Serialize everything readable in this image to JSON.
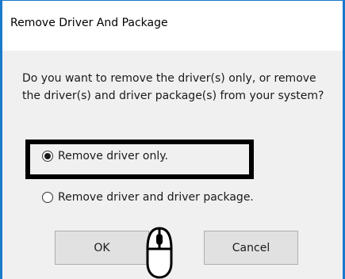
{
  "dialog": {
    "title": "Remove Driver And Package",
    "message": "Do you want to remove the driver(s) only, or remove the driver(s) and driver package(s) from your system?",
    "options": [
      {
        "label": "Remove driver only.",
        "checked": true
      },
      {
        "label": "Remove driver and driver package.",
        "checked": false
      }
    ],
    "buttons": {
      "ok_label": "OK",
      "cancel_label": "Cancel"
    }
  },
  "colors": {
    "accent_border": "#1979ca",
    "dialog_background": "#f0f0f0",
    "button_background": "#e1e1e1"
  },
  "icons": {
    "cursor": "mouse-icon"
  }
}
